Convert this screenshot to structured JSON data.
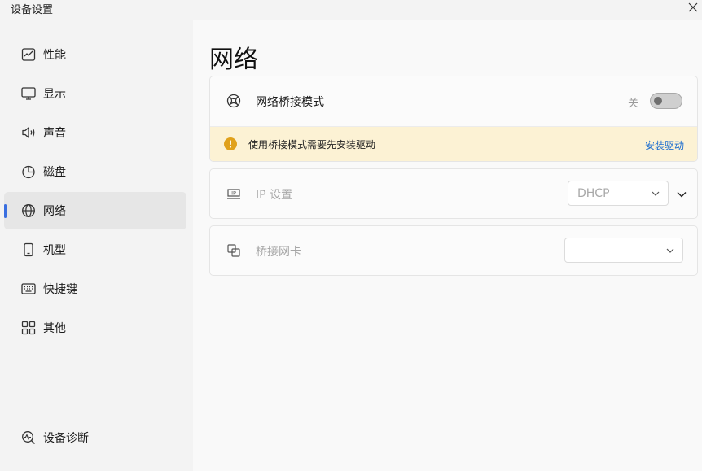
{
  "window": {
    "title": "设备设置",
    "close_icon": "close-icon"
  },
  "sidebar": {
    "items": [
      {
        "label": "性能",
        "icon": "performance-chart-icon"
      },
      {
        "label": "显示",
        "icon": "monitor-icon"
      },
      {
        "label": "声音",
        "icon": "speaker-icon"
      },
      {
        "label": "磁盘",
        "icon": "pie-chart-icon"
      },
      {
        "label": "网络",
        "icon": "globe-icon",
        "active": true
      },
      {
        "label": "机型",
        "icon": "phone-icon"
      },
      {
        "label": "快捷键",
        "icon": "keyboard-icon"
      },
      {
        "label": "其他",
        "icon": "grid-icon"
      }
    ],
    "footer": {
      "label": "设备诊断",
      "icon": "diagnose-icon"
    }
  },
  "main": {
    "title": "网络",
    "bridge": {
      "label": "网络桥接模式",
      "icon": "bridge-icon",
      "state_label": "关",
      "enabled": false
    },
    "warning": {
      "icon": "info-icon",
      "text": "使用桥接模式需要先安装驱动",
      "link": "安装驱动",
      "color": "#fcf2d4"
    },
    "ip": {
      "label": "IP 设置",
      "icon": "ip-icon",
      "select_value": "DHCP"
    },
    "adapter": {
      "label": "桥接网卡",
      "icon": "adapter-icon",
      "select_value": ""
    }
  },
  "colors": {
    "accent": "#3a6fe0",
    "link": "#1f6fd0"
  }
}
